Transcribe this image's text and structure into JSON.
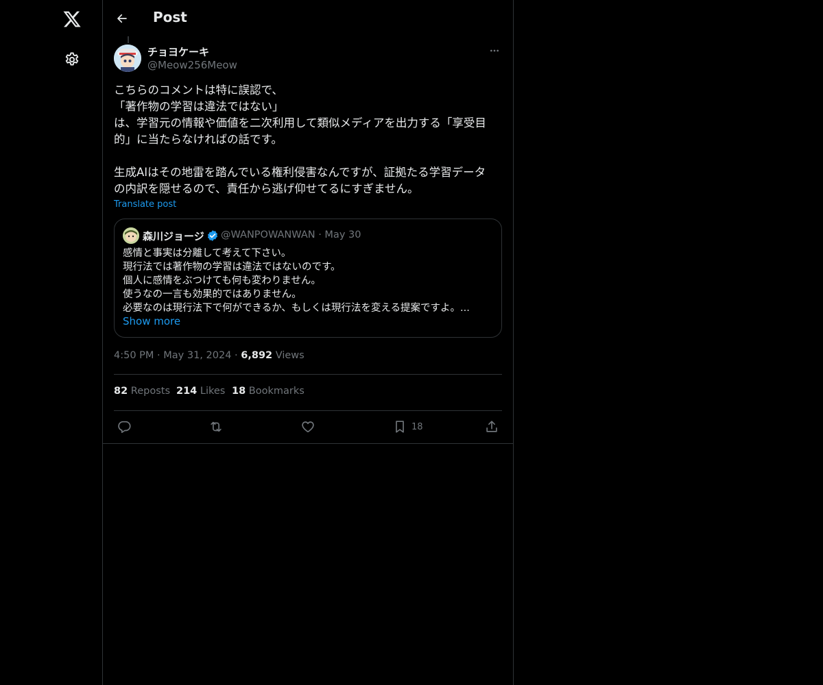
{
  "nav": {
    "logo_icon": "x-logo-icon",
    "settings_icon": "gear-icon"
  },
  "header": {
    "title": "Post"
  },
  "post": {
    "author_name": "チョヨケーキ",
    "author_handle": "@Meow256Meow",
    "text_lines": [
      "こちらのコメントは特に誤認で、",
      "「著作物の学習は違法ではない」",
      "は、学習元の情報や価値を二次利用して類似メディアを出力する「享受目",
      "的」に当たらなければの話です。",
      "",
      "生成AIはその地雷を踏んでいる権利侵害なんですが、証拠たる学習データ",
      "の内訳を隠せるので、責任から逃げ仰せてるにすぎません。"
    ],
    "translate_label": "Translate post",
    "time": "4:50 PM",
    "date": "May 31, 2024",
    "views_count": "6,892",
    "views_label": "Views"
  },
  "quote": {
    "author_name": "森川ジョージ",
    "author_handle": "@WANPOWANWAN",
    "date": "May 30",
    "text_lines": [
      "感情と事実は分離して考えて下さい。",
      "現行法では著作物の学習は違法ではないのです。",
      "個人に感情をぶつけても何も変わりません。",
      "使うなの一言も効果的ではありません。",
      "必要なのは現行法下で何ができるか、もしくは現行法を変える提案ですよ。..."
    ],
    "show_more_label": "Show more"
  },
  "stats": {
    "reposts_count": "82",
    "reposts_label": "Reposts",
    "likes_count": "214",
    "likes_label": "Likes",
    "bookmarks_count": "18",
    "bookmarks_label": "Bookmarks"
  },
  "actions": {
    "bookmark_count": "18"
  },
  "colors": {
    "background": "#000000",
    "text": "#e7e9ea",
    "muted": "#71767b",
    "accent": "#1d9bf0",
    "border": "#2f3336"
  }
}
